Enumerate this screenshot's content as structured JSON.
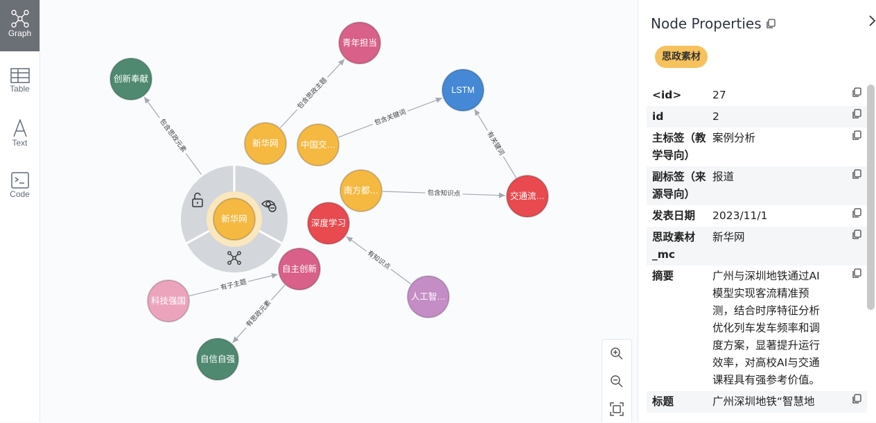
{
  "sidebar": {
    "items": [
      {
        "label": "Graph",
        "icon": "graph-icon",
        "active": true
      },
      {
        "label": "Table",
        "icon": "table-icon",
        "active": false
      },
      {
        "label": "Text",
        "icon": "text-icon",
        "active": false
      },
      {
        "label": "Code",
        "icon": "code-icon",
        "active": false
      }
    ]
  },
  "graph": {
    "nodes": [
      {
        "label": "创新奉献",
        "color": "#4f8a70"
      },
      {
        "label": "青年担当",
        "color": "#d96088"
      },
      {
        "label": "LSTM",
        "color": "#4488d6"
      },
      {
        "label": "新华网",
        "color": "#f5b942"
      },
      {
        "label": "中国交…",
        "color": "#f5b942"
      },
      {
        "label": "南方都…",
        "color": "#f5b942"
      },
      {
        "label": "交通流…",
        "color": "#e84a4f"
      },
      {
        "label": "深度学习",
        "color": "#e84a4f"
      },
      {
        "label": "新华网",
        "color": "#f5b942"
      },
      {
        "label": "自主创新",
        "color": "#d96088"
      },
      {
        "label": "科技强国",
        "color": "#eca4bd"
      },
      {
        "label": "人工智…",
        "color": "#c48dc6"
      },
      {
        "label": "自信自强",
        "color": "#4f8a70"
      }
    ],
    "edges": [
      {
        "label": "包含思政主题"
      },
      {
        "label": "包含关键词"
      },
      {
        "label": "有关键词"
      },
      {
        "label": "包含思政元素"
      },
      {
        "label": "包含知识点"
      },
      {
        "label": "有知识点"
      },
      {
        "label": "有子主题"
      },
      {
        "label": "有思政元素"
      }
    ]
  },
  "panel": {
    "title": "Node Properties",
    "badge": "思政素材",
    "colors": {
      "badge": "#f7c25d"
    },
    "properties": [
      {
        "key": "<id>",
        "value": "27"
      },
      {
        "key": "id",
        "value": "2"
      },
      {
        "key": "主标签（教\n学导向）",
        "value": "案例分析"
      },
      {
        "key": "副标签（来\n源导向）",
        "value": "报道"
      },
      {
        "key": "发表日期",
        "value": "2023/11/1"
      },
      {
        "key": "思政素材\n_mc",
        "value": "新华网"
      },
      {
        "key": "摘要",
        "value": "广州与深圳地铁通过AI\n模型实现客流精准预\n测，结合时序特征分析\n优化列车发车频率和调\n度方案，显著提升运行\n效率，对高校AI与交通\n课程具有强参考价值。"
      },
      {
        "key": "标题",
        "value": "广州深圳地铁“智慧地"
      }
    ]
  }
}
